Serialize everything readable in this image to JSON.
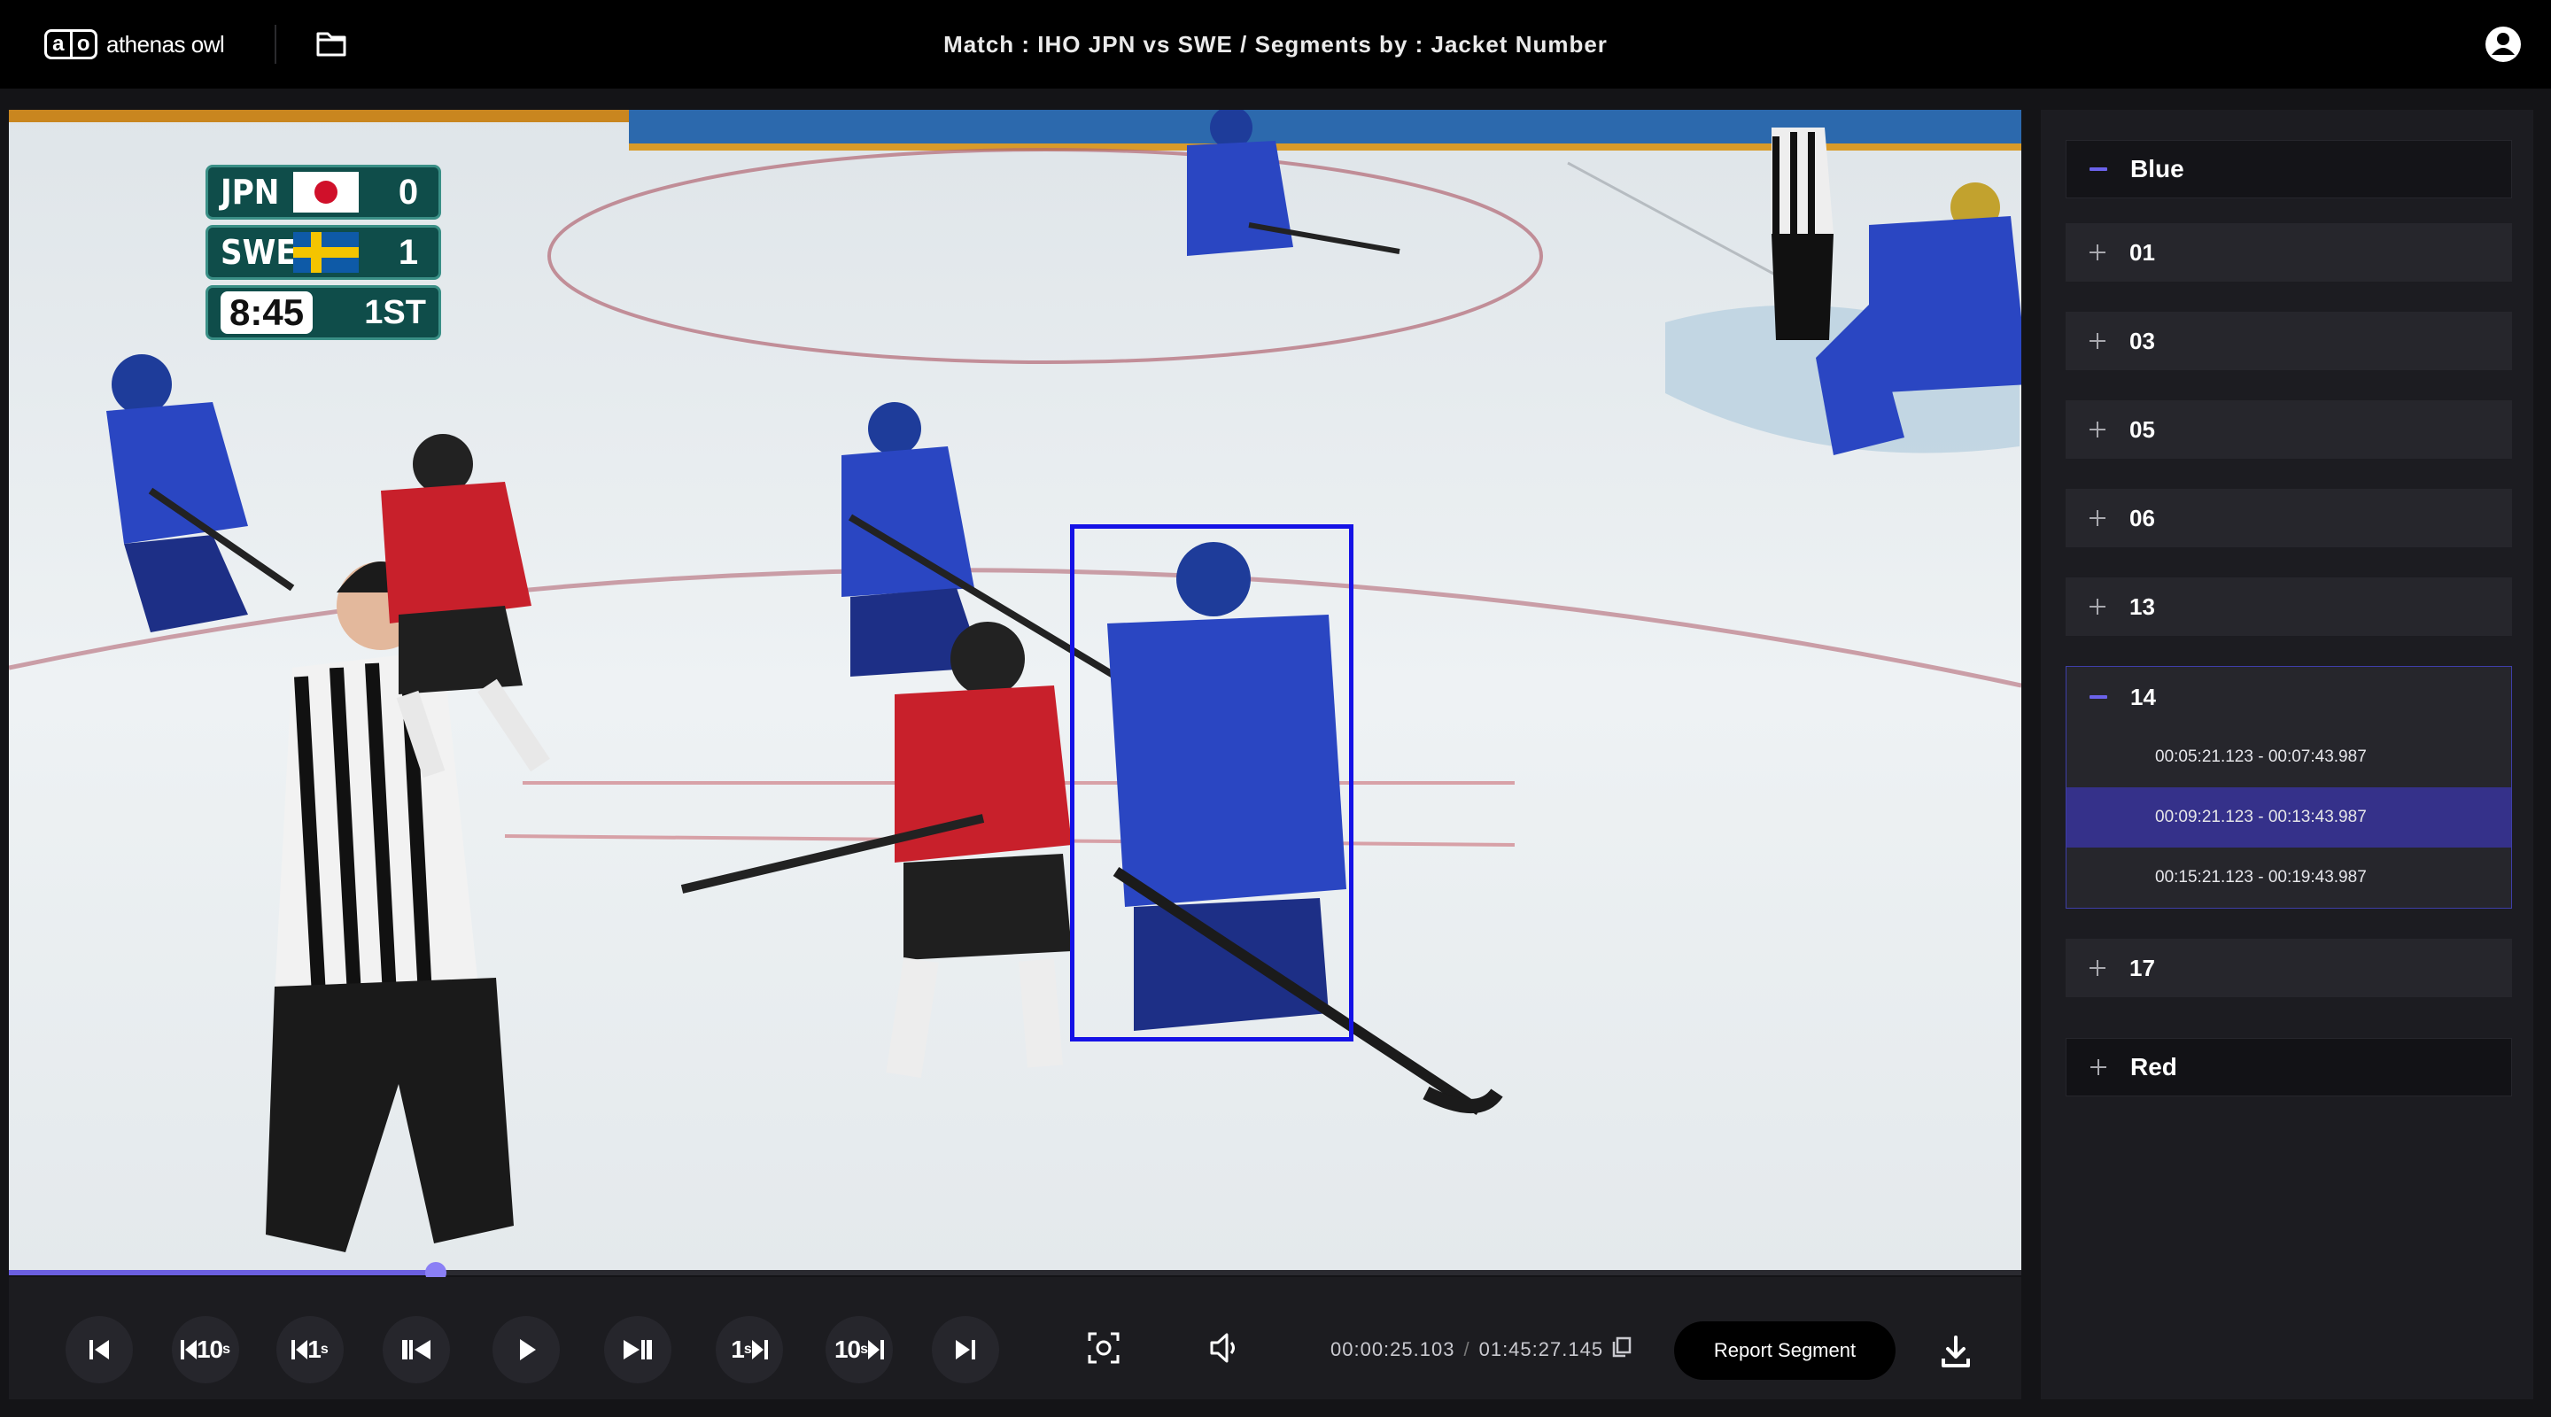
{
  "header": {
    "logo_mark_left": "a",
    "logo_mark_right": "o",
    "logo_text": "athenas owl",
    "title": "Match : IHO JPN vs SWE / Segments by : Jacket Number",
    "icons": [
      "folder-icon",
      "user-account-icon"
    ]
  },
  "video": {
    "scoreboard": {
      "rows": [
        {
          "team": "JPN",
          "score": "0"
        },
        {
          "team": "SWE",
          "score": "1"
        }
      ],
      "clock": "8:45",
      "period": "1ST"
    },
    "detection_box_color": "#1512e6"
  },
  "player": {
    "progress_fraction": 0.212,
    "progress_color": "#6b5fe0",
    "controls": {
      "back10": "10",
      "back10_unit": "s",
      "back1": "1",
      "back1_unit": "s",
      "fwd1": "1",
      "fwd1_unit": "s",
      "fwd10": "10",
      "fwd10_unit": "s"
    },
    "icons": [
      "skip-to-start-icon",
      "previous-frame-icon",
      "play-icon",
      "next-frame-icon",
      "skip-to-end-icon",
      "screenshot-icon",
      "volume-icon",
      "copy-icon",
      "download-icon"
    ],
    "current_time": "00:00:25.103",
    "separator": "/",
    "total_time": "01:45:27.145",
    "report_label": "Report Segment"
  },
  "sidebar": {
    "groups": [
      {
        "label": "Blue",
        "expanded": true
      },
      {
        "label": "Red",
        "expanded": false
      }
    ],
    "jackets": [
      {
        "label": "01",
        "expanded": false
      },
      {
        "label": "03",
        "expanded": false
      },
      {
        "label": "05",
        "expanded": false
      },
      {
        "label": "06",
        "expanded": false
      },
      {
        "label": "13",
        "expanded": false
      },
      {
        "label": "14",
        "expanded": true
      },
      {
        "label": "17",
        "expanded": false
      }
    ],
    "segments": [
      {
        "label": "00:05:21.123 - 00:07:43.987",
        "active": false
      },
      {
        "label": "00:09:21.123 - 00:13:43.987",
        "active": true
      },
      {
        "label": "00:15:21.123 - 00:19:43.987",
        "active": false
      }
    ],
    "accent_color": "#6b62ea",
    "active_segment_color": "#35318a"
  }
}
